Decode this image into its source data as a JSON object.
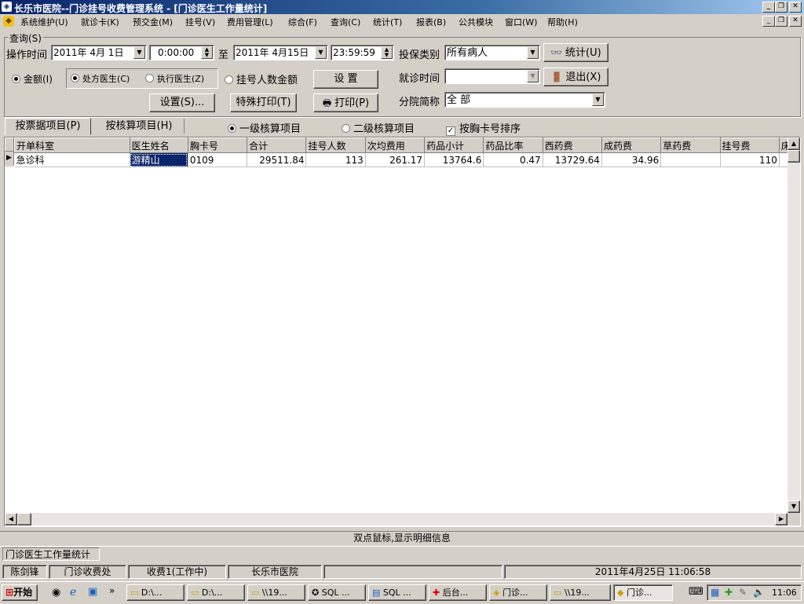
{
  "window": {
    "title": "长乐市医院--门诊挂号收费管理系统 - [门诊医生工作量统计]"
  },
  "menu": [
    "系统维护(U)",
    "就诊卡(K)",
    "预交金(M)",
    "挂号(V)",
    "费用管理(L)",
    "综合(F)",
    "查询(C)",
    "统计(T)",
    "报表(B)",
    "公共模块",
    "窗口(W)",
    "帮助(H)"
  ],
  "query": {
    "group_label": "查询(S)",
    "op_time_label": "操作时间",
    "date_from": "2011年 4月 1日",
    "time_from": "0:00:00",
    "to_label": "至",
    "date_to": "2011年 4月15日",
    "time_to": "23:59:59",
    "ins_type_label": "投保类别",
    "ins_type_value": "所有病人",
    "stat_button": "统计(U)",
    "exit_button": "退出(X)",
    "visit_time_label": "就诊时间",
    "visit_time_value": "",
    "branch_label": "分院简称",
    "branch_value": "全 部",
    "radio_amount": "金额(I)",
    "radio_prescribing": "处方医生(C)",
    "radio_executing": "执行医生(Z)",
    "radio_reg_count": "挂号人数金额",
    "settings_button": "设 置",
    "settings2_button": "设置(S)...",
    "special_print_button": "特殊打印(T)",
    "print_button": "打印(P)"
  },
  "tabs": {
    "by_receipt": "按票据项目(P)",
    "by_accounting": "按核算项目(H)",
    "level1": "一级核算项目",
    "level2": "二级核算项目",
    "sort_by_card": "按胸卡号排序"
  },
  "table": {
    "columns": [
      "开单科室",
      "医生姓名",
      "胸卡号",
      "合计",
      "挂号人数",
      "次均费用",
      "药品小计",
      "药品比率",
      "西药费",
      "成药费",
      "草药费",
      "挂号费",
      "床"
    ],
    "rows": [
      [
        "急诊科",
        "游精山",
        "0109",
        "29511.84",
        "113",
        "261.17",
        "13764.6",
        "0.47",
        "13729.64",
        "34.96",
        "",
        "110",
        ""
      ]
    ]
  },
  "hint": "双点鼠标,显示明细信息",
  "mdi_tab": "门诊医生工作量统计",
  "status": {
    "user": "陈剑锋",
    "dept": "门诊收费处",
    "station": "收费1(工作中)",
    "hospital": "长乐市医院",
    "datetime": "2011年4月25日 11:06:58"
  },
  "taskbar": {
    "start": "开始",
    "more": "»",
    "tasks": [
      "D:\\...",
      "D:\\...",
      "\\\\19...",
      "SQL ...",
      "SQL ...",
      "后台...",
      "门诊...",
      "\\\\19...",
      "门诊..."
    ],
    "clock": "11:06"
  }
}
